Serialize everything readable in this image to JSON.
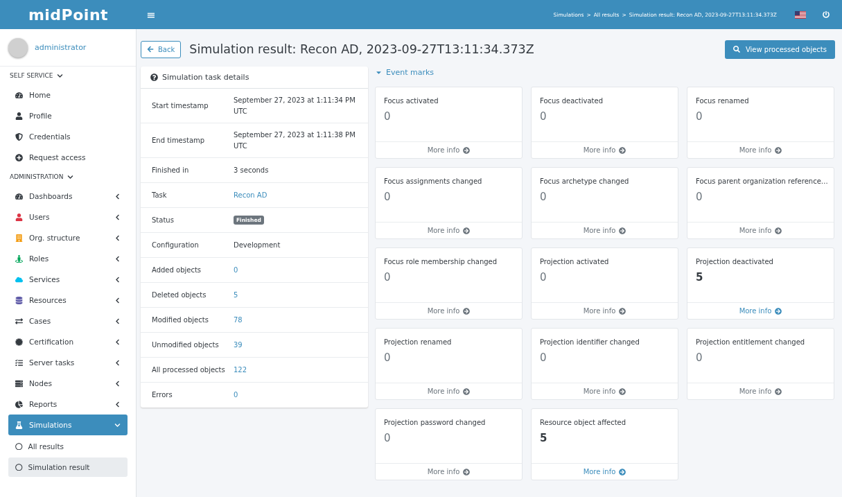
{
  "logo": "midPoint",
  "header": {
    "menu": "≡",
    "separator": ">",
    "breadcrumbs": [
      "Simulations",
      "All results",
      "Simulation result: Recon AD, 2023-09-27T13:11:34.373Z"
    ]
  },
  "user": {
    "name": "administrator"
  },
  "sidebar": {
    "sections": [
      {
        "title": "SELF SERVICE",
        "expanded": true,
        "items": [
          {
            "label": "Home",
            "has_submenu": false,
            "selected": false
          },
          {
            "label": "Profile",
            "has_submenu": false,
            "selected": false
          },
          {
            "label": "Credentials",
            "has_submenu": false,
            "selected": false
          },
          {
            "label": "Request access",
            "has_submenu": false,
            "selected": false
          }
        ]
      },
      {
        "title": "ADMINISTRATION",
        "expanded": true,
        "items": [
          {
            "label": "Dashboards",
            "has_submenu": true,
            "selected": false
          },
          {
            "label": "Users",
            "has_submenu": true,
            "selected": false
          },
          {
            "label": "Org. structure",
            "has_submenu": true,
            "selected": false
          },
          {
            "label": "Roles",
            "has_submenu": true,
            "selected": false
          },
          {
            "label": "Services",
            "has_submenu": true,
            "selected": false
          },
          {
            "label": "Resources",
            "has_submenu": true,
            "selected": false
          },
          {
            "label": "Cases",
            "has_submenu": true,
            "selected": false
          },
          {
            "label": "Certification",
            "has_submenu": true,
            "selected": false
          },
          {
            "label": "Server tasks",
            "has_submenu": true,
            "selected": false
          },
          {
            "label": "Nodes",
            "has_submenu": true,
            "selected": false
          },
          {
            "label": "Reports",
            "has_submenu": true,
            "selected": false
          },
          {
            "label": "Simulations",
            "has_submenu": true,
            "selected": true,
            "expanded": true,
            "children": [
              {
                "label": "All results",
                "selected": false
              },
              {
                "label": "Simulation result",
                "selected": true
              }
            ]
          }
        ]
      }
    ]
  },
  "page": {
    "back": "Back",
    "title": "Simulation result: Recon AD, 2023-09-27T13:11:34.373Z",
    "action": "View processed objects"
  },
  "details": {
    "title": "Simulation task details",
    "rows": [
      {
        "label": "Start timestamp",
        "value": "September 27, 2023 at 1:11:34 PM UTC",
        "kind": "text"
      },
      {
        "label": "End timestamp",
        "value": "September 27, 2023 at 1:11:38 PM UTC",
        "kind": "text"
      },
      {
        "label": "Finished in",
        "value": "3 seconds",
        "kind": "text"
      },
      {
        "label": "Task",
        "value": "Recon AD",
        "kind": "link"
      },
      {
        "label": "Status",
        "value": "Finished",
        "kind": "badge"
      },
      {
        "label": "Configuration",
        "value": "Development",
        "kind": "text"
      },
      {
        "label": "Added objects",
        "value": "0",
        "kind": "link"
      },
      {
        "label": "Deleted objects",
        "value": "5",
        "kind": "link"
      },
      {
        "label": "Modified objects",
        "value": "78",
        "kind": "link"
      },
      {
        "label": "Unmodified objects",
        "value": "39",
        "kind": "link"
      },
      {
        "label": "All processed objects",
        "value": "122",
        "kind": "link"
      },
      {
        "label": "Errors",
        "value": "0",
        "kind": "link"
      }
    ]
  },
  "event_marks": {
    "title": "Event marks",
    "expanded": true,
    "cards": [
      {
        "title": "Focus activated",
        "count": "0",
        "link": "More info",
        "active": false
      },
      {
        "title": "Focus deactivated",
        "count": "0",
        "link": "More info",
        "active": false
      },
      {
        "title": "Focus renamed",
        "count": "0",
        "link": "More info",
        "active": false
      },
      {
        "title": "Focus assignments changed",
        "count": "0",
        "link": "More info",
        "active": false
      },
      {
        "title": "Focus archetype changed",
        "count": "0",
        "link": "More info",
        "active": false
      },
      {
        "title": "Focus parent organization reference…",
        "count": "0",
        "link": "More info",
        "active": false
      },
      {
        "title": "Focus role membership changed",
        "count": "0",
        "link": "More info",
        "active": false
      },
      {
        "title": "Projection activated",
        "count": "0",
        "link": "More info",
        "active": false
      },
      {
        "title": "Projection deactivated",
        "count": "5",
        "link": "More info",
        "active": true
      },
      {
        "title": "Projection renamed",
        "count": "0",
        "link": "More info",
        "active": false
      },
      {
        "title": "Projection identifier changed",
        "count": "0",
        "link": "More info",
        "active": false
      },
      {
        "title": "Projection entitlement changed",
        "count": "0",
        "link": "More info",
        "active": false
      },
      {
        "title": "Projection password changed",
        "count": "0",
        "link": "More info",
        "active": false
      },
      {
        "title": "Resource object affected",
        "count": "5",
        "link": "More info",
        "active": true
      }
    ]
  }
}
